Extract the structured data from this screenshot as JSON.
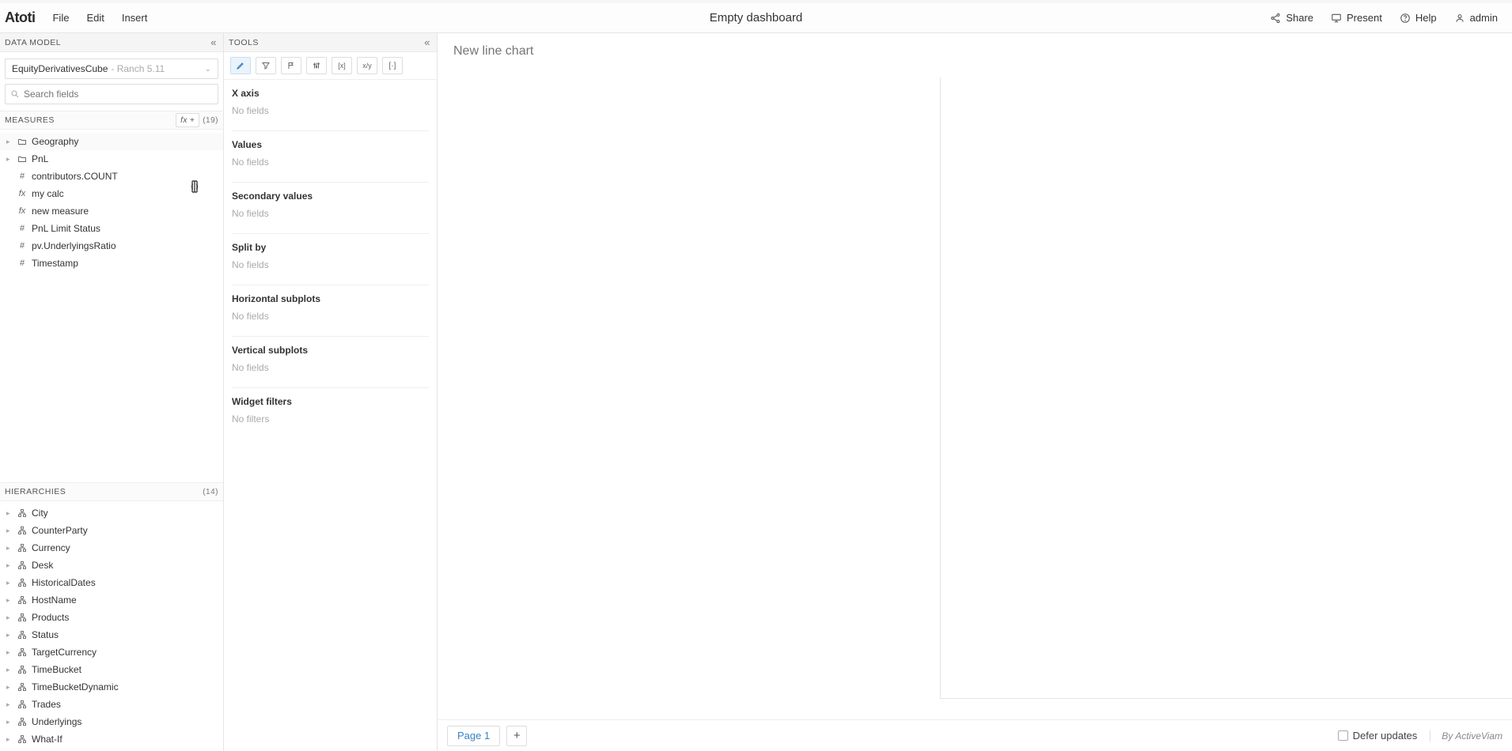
{
  "app": {
    "logo": "Atoti"
  },
  "menu": {
    "file": "File",
    "edit": "Edit",
    "insert": "Insert"
  },
  "dashboard": {
    "title": "Empty dashboard"
  },
  "topRight": {
    "share": "Share",
    "present": "Present",
    "help": "Help",
    "user": "admin"
  },
  "dataModel": {
    "header": "DATA MODEL",
    "cube": {
      "name": "EquityDerivativesCube",
      "version": "- Ranch 5.11"
    },
    "search": {
      "placeholder": "Search fields"
    },
    "measures": {
      "header": "MEASURES",
      "fxLabel": "fx",
      "count": "(19)",
      "items": [
        {
          "icon": "folder",
          "label": "Geography",
          "caret": true
        },
        {
          "icon": "folder",
          "label": "PnL",
          "caret": true
        },
        {
          "icon": "hash",
          "label": "contributors.COUNT",
          "caret": false
        },
        {
          "icon": "fx",
          "label": "my calc",
          "caret": false
        },
        {
          "icon": "fx",
          "label": "new measure",
          "caret": false
        },
        {
          "icon": "hash",
          "label": "PnL Limit Status",
          "caret": false
        },
        {
          "icon": "hash",
          "label": "pv.UnderlyingsRatio",
          "caret": false
        },
        {
          "icon": "hash",
          "label": "Timestamp",
          "caret": false
        }
      ]
    },
    "hierarchies": {
      "header": "HIERARCHIES",
      "count": "(14)",
      "items": [
        {
          "label": "City"
        },
        {
          "label": "CounterParty"
        },
        {
          "label": "Currency"
        },
        {
          "label": "Desk"
        },
        {
          "label": "HistoricalDates"
        },
        {
          "label": "HostName"
        },
        {
          "label": "Products"
        },
        {
          "label": "Status"
        },
        {
          "label": "TargetCurrency"
        },
        {
          "label": "TimeBucket"
        },
        {
          "label": "TimeBucketDynamic"
        },
        {
          "label": "Trades"
        },
        {
          "label": "Underlyings"
        },
        {
          "label": "What-If"
        }
      ]
    }
  },
  "tools": {
    "header": "TOOLS",
    "tabs": {
      "design": "✎",
      "funnel": "▽",
      "flag": "⚐",
      "sliders": "↕↕",
      "brackets": "[x]",
      "xy": "x/y",
      "width": "[·]"
    },
    "sections": [
      {
        "title": "X axis",
        "empty": "No fields"
      },
      {
        "title": "Values",
        "empty": "No fields"
      },
      {
        "title": "Secondary values",
        "empty": "No fields"
      },
      {
        "title": "Split by",
        "empty": "No fields"
      },
      {
        "title": "Horizontal subplots",
        "empty": "No fields"
      },
      {
        "title": "Vertical subplots",
        "empty": "No fields"
      },
      {
        "title": "Widget filters",
        "empty": "No filters"
      }
    ]
  },
  "canvas": {
    "widgetTitlePlaceholder": "New line chart",
    "page1": "Page 1"
  },
  "footer": {
    "defer": "Defer updates",
    "by": "By ActiveViam"
  }
}
